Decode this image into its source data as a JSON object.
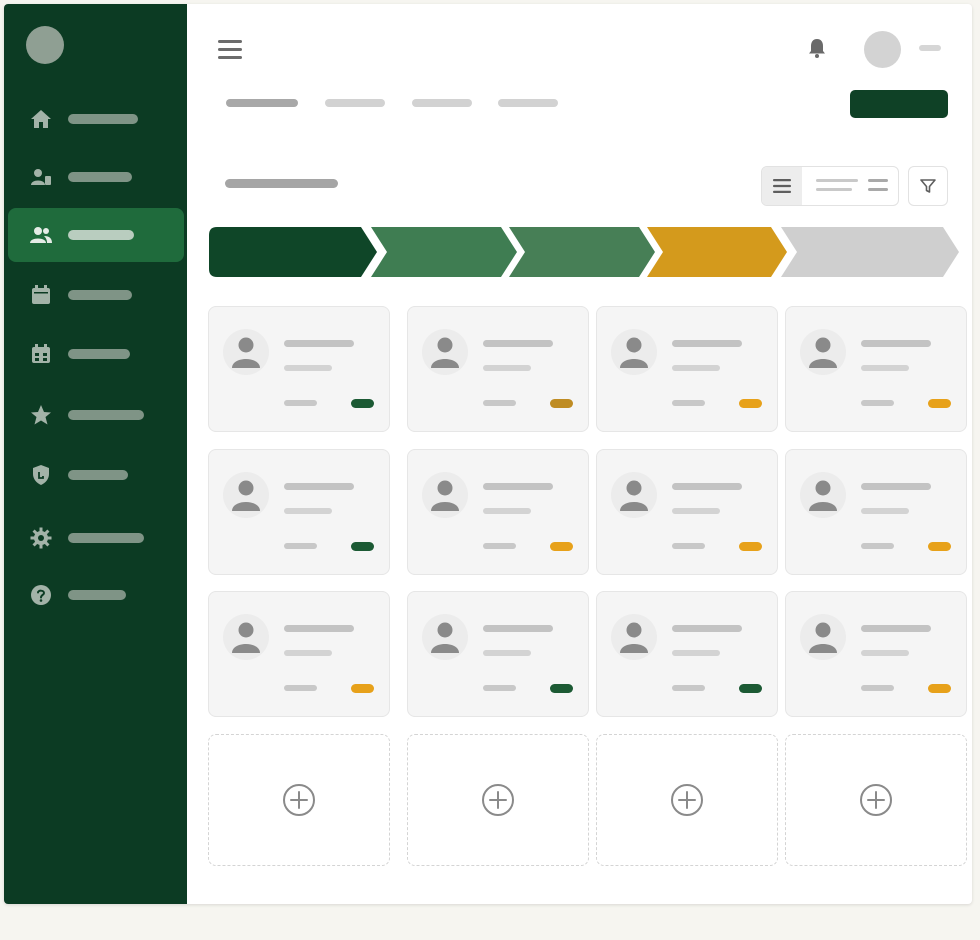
{
  "colors": {
    "sidebar_bg": "#0c3b23",
    "sidebar_active": "#1f6b3c",
    "primary": "#0f4126",
    "stage_dark_green": "#0f4628",
    "stage_green": "#3f7d52",
    "stage_amber": "#d49a1c",
    "stage_gray": "#cfcfcf",
    "status_green": "#1c5a34",
    "status_amber": "#e7a11a",
    "status_olive": "#bf8c23"
  },
  "sidebar": {
    "items": [
      {
        "icon": "home-icon",
        "active": false
      },
      {
        "icon": "contacts-icon",
        "active": false
      },
      {
        "icon": "users-icon",
        "active": true
      },
      {
        "icon": "calendar-icon",
        "active": false
      },
      {
        "icon": "schedule-icon",
        "active": false
      },
      {
        "icon": "star-icon",
        "active": false
      },
      {
        "icon": "shield-icon",
        "active": false
      },
      {
        "icon": "gear-icon",
        "active": false
      },
      {
        "icon": "help-icon",
        "active": false
      }
    ]
  },
  "header": {
    "icons": [
      "menu-icon",
      "bell-icon"
    ],
    "tabs_count": 4,
    "active_tab_index": 0
  },
  "pipeline": {
    "stages": [
      "dark-green",
      "green",
      "green",
      "amber",
      "gray"
    ]
  },
  "cards": [
    {
      "status": "green"
    },
    {
      "status": "olive"
    },
    {
      "status": "amber"
    },
    {
      "status": "amber"
    },
    {
      "status": "green"
    },
    {
      "status": "amber"
    },
    {
      "status": "amber"
    },
    {
      "status": "amber"
    },
    {
      "status": "amber"
    },
    {
      "status": "green"
    },
    {
      "status": "green"
    },
    {
      "status": "amber"
    }
  ],
  "add_slots": 4
}
